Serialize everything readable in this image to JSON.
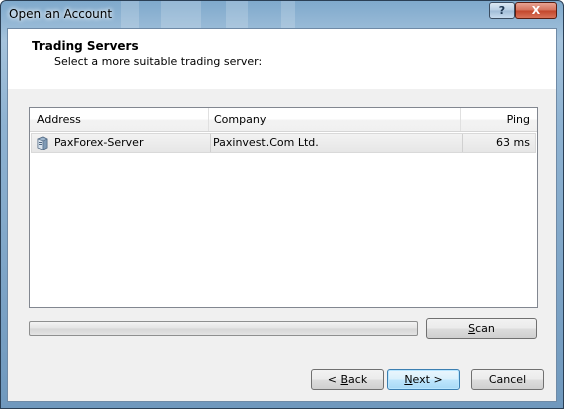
{
  "window": {
    "title": "Open an Account",
    "help_label": "?",
    "close_label": "X"
  },
  "header": {
    "title": "Trading Servers",
    "subtitle": "Select a more suitable trading server:"
  },
  "server_table": {
    "columns": [
      "Address",
      "Company",
      "Ping"
    ],
    "rows": [
      {
        "address": "PaxForex-Server",
        "company": "Paxinvest.Com Ltd.",
        "ping": "63 ms",
        "icon": "server-icon"
      }
    ]
  },
  "scan": {
    "progress": 0,
    "button_key": "S",
    "button_rest": "can"
  },
  "nav": {
    "back_prefix": "< ",
    "back_key": "B",
    "back_rest": "ack",
    "next_key": "N",
    "next_rest": "ext >",
    "cancel_label": "Cancel"
  },
  "colors": {
    "accent": "#3c7fb1",
    "close_button": "#c2452a",
    "selected_row": "#e6e6e6"
  }
}
